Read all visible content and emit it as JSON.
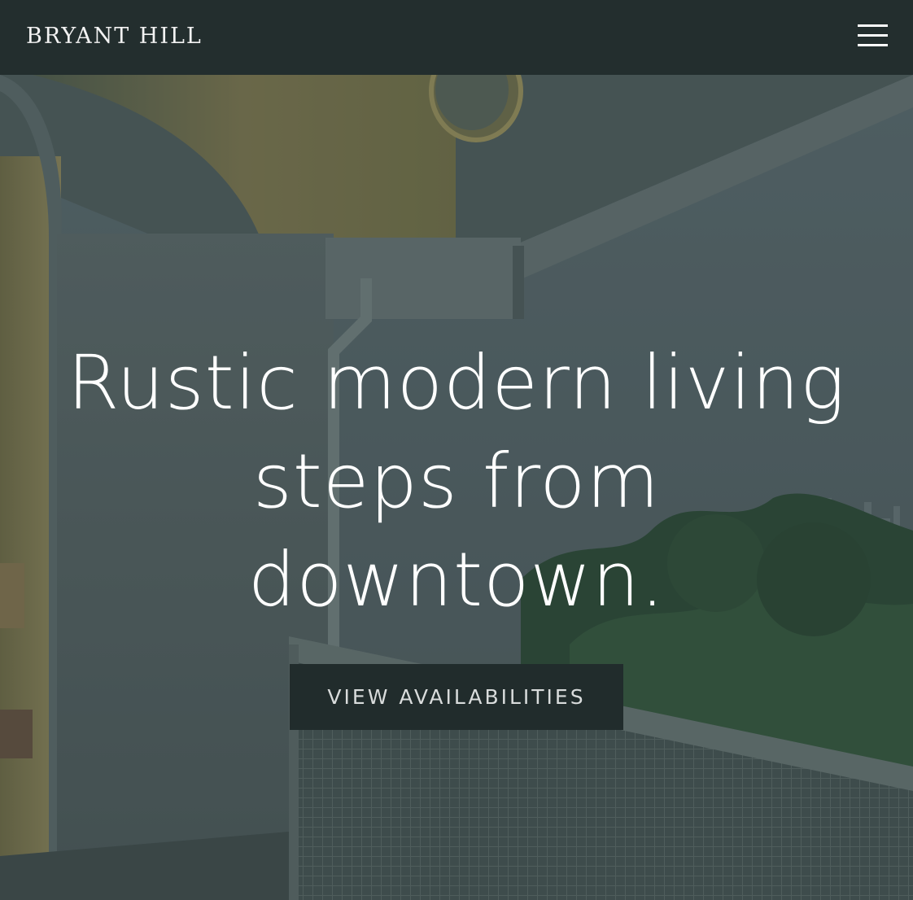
{
  "header": {
    "brand": "BRYANT HILL",
    "menu_icon": "hamburger-menu-icon"
  },
  "hero": {
    "headline_lines": [
      "Rustic modern living",
      "steps from",
      "downtown."
    ],
    "cta_label": "VIEW AVAILABILITIES",
    "background_image": "balcony-city-view-photo"
  },
  "colors": {
    "header_bg": "#232e2e",
    "cta_bg": "#212c2c",
    "text": "#ffffff"
  }
}
